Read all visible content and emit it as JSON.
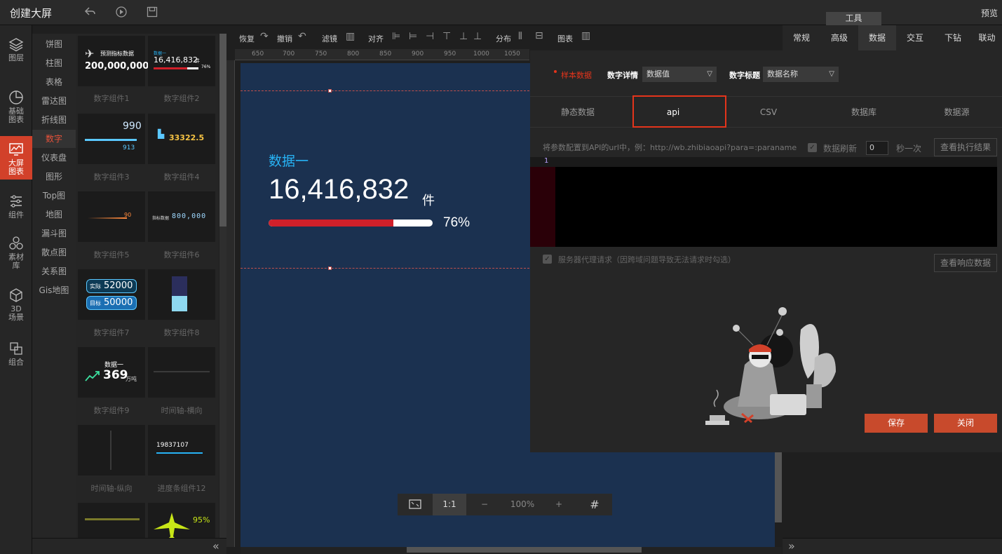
{
  "header": {
    "title": "创建大屏",
    "preview": "预览",
    "tools_tab": "工具"
  },
  "leftnav": [
    {
      "label": "图层",
      "icon": "layers-icon"
    },
    {
      "label": "基础图表",
      "icon": "pie-chart-icon"
    },
    {
      "label": "大屏图表",
      "icon": "screen-chart-icon"
    },
    {
      "label": "组件",
      "icon": "sliders-icon"
    },
    {
      "label": "素材库",
      "icon": "hexagons-icon"
    },
    {
      "label": "3D场景",
      "icon": "cube-icon"
    },
    {
      "label": "组合",
      "icon": "combine-icon"
    }
  ],
  "categories": [
    "饼图",
    "柱图",
    "表格",
    "雷达图",
    "折线图",
    "数字",
    "仪表盘",
    "图形",
    "Top图",
    "地图",
    "漏斗图",
    "散点图",
    "关系图",
    "Gis地图"
  ],
  "active_category": "数字",
  "components": [
    {
      "label": "数字组件1",
      "preview_title": "预测指标数据",
      "preview_value": "200,000,000"
    },
    {
      "label": "数字组件2",
      "preview_title": "数据一",
      "preview_value": "16,416,832",
      "preview_unit": "件",
      "preview_pct": "76%"
    },
    {
      "label": "数字组件3",
      "preview_value": "990",
      "preview_value2": "913"
    },
    {
      "label": "数字组件4",
      "preview_value": "33322.5"
    },
    {
      "label": "数字组件5",
      "preview_value": "90"
    },
    {
      "label": "数字组件6",
      "preview_title": "指标数据",
      "preview_value": "800,000"
    },
    {
      "label": "数字组件7",
      "preview_label_a": "实际",
      "preview_value": "52000",
      "preview_label_b": "目标",
      "preview_value2": "50000"
    },
    {
      "label": "数字组件8"
    },
    {
      "label": "数字组件9",
      "preview_title": "数据一",
      "preview_value": "369",
      "preview_unit": "万吨"
    },
    {
      "label": "时间轴-横向"
    },
    {
      "label": "时间轴-纵向"
    },
    {
      "label": "进度条组件12",
      "preview_value": "19837107"
    },
    {
      "label": ""
    },
    {
      "label": "",
      "preview_pct": "95%"
    }
  ],
  "toolbar": {
    "redo": "恢复",
    "undo": "撤销",
    "filter": "滤镜",
    "align": "对齐",
    "distribute": "分布",
    "chart": "图表"
  },
  "ruler_ticks": [
    "650",
    "700",
    "750",
    "800",
    "850",
    "900",
    "950",
    "1000",
    "1050"
  ],
  "widget": {
    "title": "数据一",
    "value": "16,416,832",
    "unit": "件",
    "percent_label": "76%",
    "progress_fraction": 0.76
  },
  "zoom": {
    "ratio_label": "1:1",
    "minus": "−",
    "level": "100%",
    "plus": "+"
  },
  "right_tabs": [
    "常规",
    "高级",
    "数据",
    "交互",
    "下钻",
    "联动"
  ],
  "active_right_tab": "数据",
  "data_panel": {
    "sample_data": "样本数据",
    "detail_label": "数字详情",
    "detail_value": "数据值",
    "title_label": "数字标题",
    "title_value": "数据名称",
    "tabs": [
      "静态数据",
      "api",
      "CSV",
      "数据库",
      "数据源"
    ],
    "active_tab": "api",
    "hint": "将参数配置到API的url中，例：http://wb.zhibiaoapi?para=:paraname",
    "refresh_label": "数据刷新",
    "refresh_value": "0",
    "refresh_unit": "秒一次",
    "view_result": "查看执行结果",
    "line_number": "1",
    "proxy_label": "服务器代理请求（因跨域问题导致无法请求时勾选）",
    "view_response": "查看响应数据",
    "save": "保存",
    "close": "关闭"
  },
  "colors": {
    "accent": "#d2412a",
    "canvas_bg": "#1b3150",
    "widget_title": "#27b3f5",
    "progress_red": "#d0202a",
    "highlight_border": "#e4341b"
  }
}
